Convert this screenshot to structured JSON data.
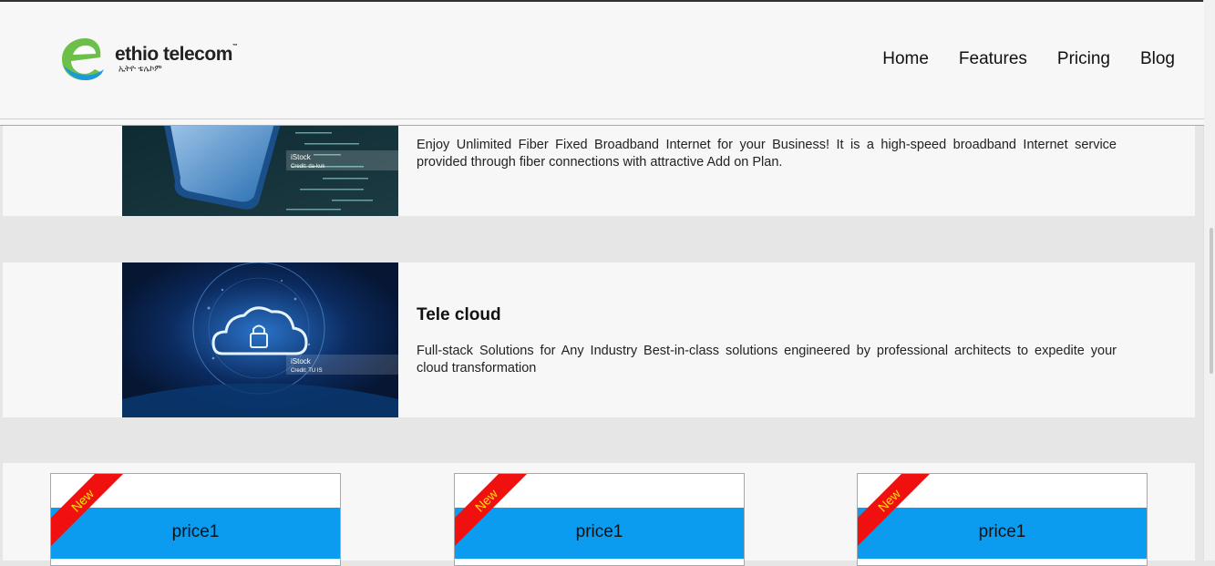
{
  "header": {
    "brand": "ethio telecom",
    "brand_sub": "ኢትዮ ቴሌኮም",
    "trademark": "™",
    "nav": [
      "Home",
      "Features",
      "Pricing",
      "Blog"
    ]
  },
  "cards": [
    {
      "title": "",
      "desc": "Enjoy Unlimited Fiber Fixed Broadband Internet for your Business! It is a high-speed broadband Internet service provided through fiber connections with attractive Add on Plan.",
      "image_stock": "iStock",
      "image_credit": "Credit: da-kuk"
    },
    {
      "title": "Tele cloud",
      "desc": "Full-stack Solutions for Any Industry Best-in-class solutions engineered by professional architects to expedite your cloud transformation",
      "image_stock": "iStock",
      "image_credit": "Credit: TU IS"
    }
  ],
  "pricing": [
    {
      "ribbon": "New",
      "label": "price1"
    },
    {
      "ribbon": "New",
      "label": "price1"
    },
    {
      "ribbon": "New",
      "label": "price1"
    }
  ],
  "colors": {
    "accent_blue": "#0b9bef",
    "ribbon_red": "#f01010",
    "ribbon_text": "#ffe300",
    "logo_green": "#6cc04a",
    "logo_blue": "#1a9ad6"
  }
}
